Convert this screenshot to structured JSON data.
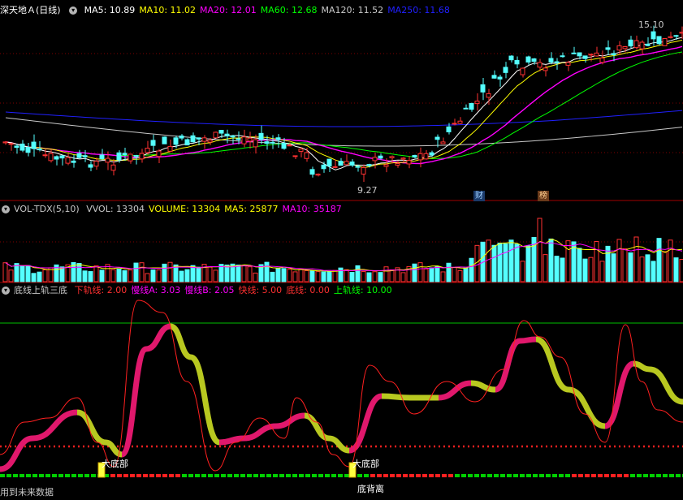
{
  "price_panel": {
    "title": "深天地Ａ",
    "period": "(日线)",
    "ma": [
      {
        "label": "MA5:",
        "value": "10.89",
        "color": "#ffffff"
      },
      {
        "label": "MA10:",
        "value": "11.02",
        "color": "#ffff00"
      },
      {
        "label": "MA20:",
        "value": "12.01",
        "color": "#ff00ff"
      },
      {
        "label": "MA60:",
        "value": "12.68",
        "color": "#00ff00"
      },
      {
        "label": "MA120:",
        "value": "11.52",
        "color": "#c8c8c8"
      },
      {
        "label": "MA250:",
        "value": "11.68",
        "color": "#2020ff"
      }
    ],
    "high_label": "15.10",
    "low_label": "9.27",
    "badge_cai": "财",
    "badge_bang": "榜"
  },
  "volume_panel": {
    "title": "VOL-TDX(5,10)",
    "items": [
      {
        "label": "VVOL:",
        "value": "13304",
        "color": "#c8c8c8"
      },
      {
        "label": "VOLUME:",
        "value": "13304",
        "color": "#ffff00"
      },
      {
        "label": "MA5:",
        "value": "25877",
        "color": "#ffff00"
      },
      {
        "label": "MA10:",
        "value": "35187",
        "color": "#ff00ff"
      }
    ]
  },
  "indicator_panel": {
    "title": "底线上轨三底",
    "items": [
      {
        "label": "下轨线:",
        "value": "2.00",
        "color": "#ff3030"
      },
      {
        "label": "慢线A:",
        "value": "3.03",
        "color": "#ff00ff"
      },
      {
        "label": "慢线B:",
        "value": "2.05",
        "color": "#ff00ff"
      },
      {
        "label": "快线:",
        "value": "5.00",
        "color": "#ff3030"
      },
      {
        "label": "底线:",
        "value": "0.00",
        "color": "#ff3030"
      },
      {
        "label": "上轨线:",
        "value": "10.00",
        "color": "#00ff00"
      }
    ],
    "signal_label_1": "大底部",
    "signal_label_2": "大底部",
    "divergence_label": "底背离"
  },
  "footer_text": "用到未来数据",
  "colors": {
    "up": "#ff3232",
    "down": "#54ffff",
    "grid": "#800000",
    "ma5": "#ffffff",
    "ma10": "#ffff00",
    "ma20": "#ff00ff",
    "ma60": "#00ff00",
    "ma120": "#c8c8c8",
    "ma250": "#2020ff",
    "ind_thick_a": "#e0186c",
    "ind_thick_b": "#b8c820",
    "ind_thin": "#ff2020",
    "upper_line": "#00c000",
    "baseline_dots": "#ff2020"
  }
}
